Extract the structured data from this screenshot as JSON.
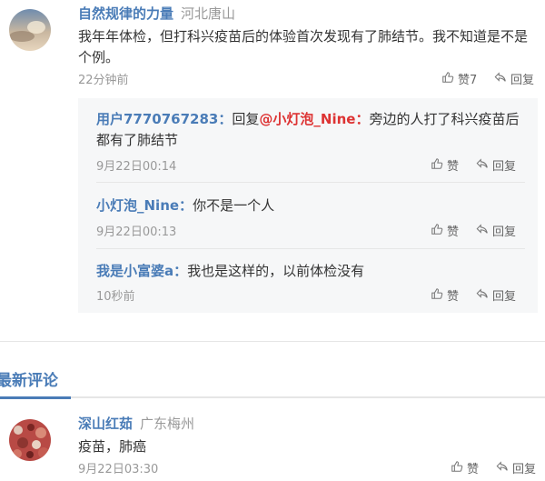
{
  "comment1": {
    "name": "自然规律的力量",
    "location": "河北唐山",
    "text": "我年年体检，但打科兴疫苗后的体验首次发现有了肺结节。我不知道是不是个例。",
    "time": "22分钟前",
    "like_label": "赞7",
    "reply_label": "回复",
    "replies": [
      {
        "name": "用户7770767283：",
        "prefix": "回复",
        "mention": "@小灯泡_Nine：",
        "text": "旁边的人打了科兴疫苗后都有了肺结节",
        "time": "9月22日00:14",
        "like_label": "赞",
        "reply_label": "回复"
      },
      {
        "name": "小灯泡_Nine：",
        "text": "你不是一个人",
        "time": "9月22日00:13",
        "like_label": "赞",
        "reply_label": "回复"
      },
      {
        "name": "我是小富婆a：",
        "text": "我也是这样的，以前体检没有",
        "time": "10秒前",
        "like_label": "赞",
        "reply_label": "回复"
      }
    ]
  },
  "latest": {
    "title": "最新评论"
  },
  "comment2": {
    "name": "深山红茹",
    "location": "广东梅州",
    "text": "疫苗，肺癌",
    "time": "9月22日03:30",
    "like_label": "赞",
    "reply_label": "回复"
  },
  "colors": {
    "name_blue": "#4a7cb7",
    "mention_red": "#d33",
    "muted": "#999999",
    "reply_bg": "#f6f7f8"
  }
}
